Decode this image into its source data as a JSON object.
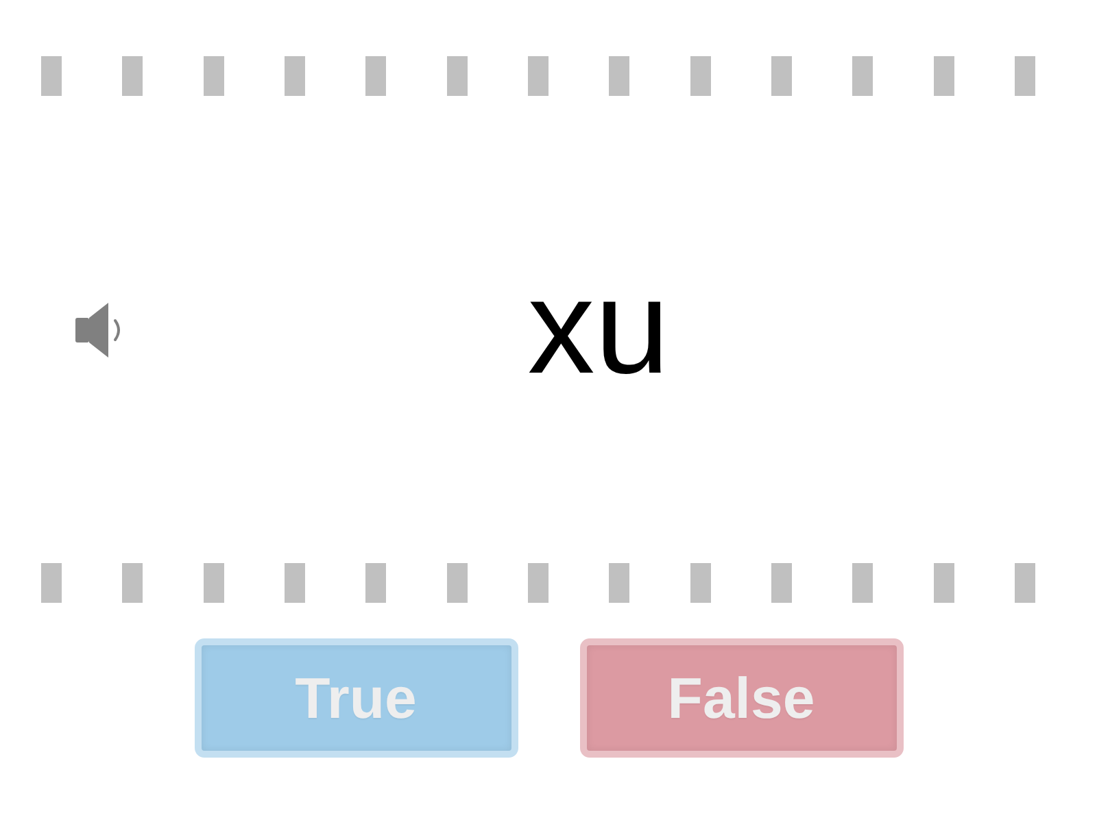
{
  "prompt": {
    "word": "xu"
  },
  "answers": [
    {
      "label": "True",
      "color": "#9ecbe8"
    },
    {
      "label": "False",
      "color": "#dc9aa2"
    }
  ]
}
